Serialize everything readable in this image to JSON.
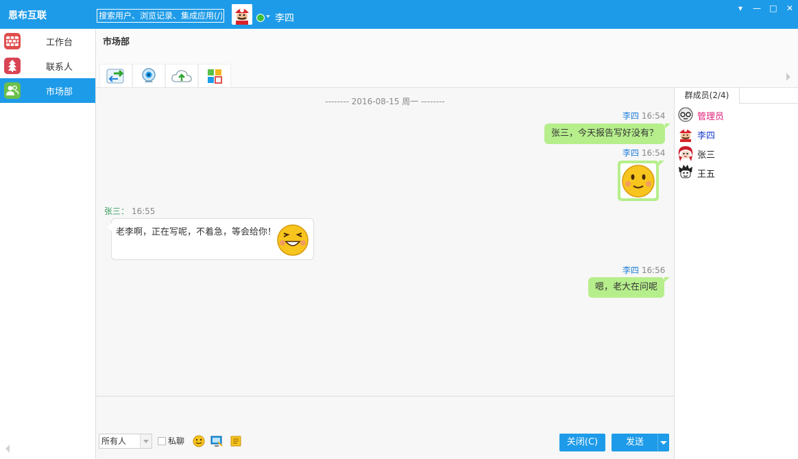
{
  "app": {
    "title": "恩布互联"
  },
  "search": {
    "placeholder": "搜索用户、浏览记录、集成应用(/)"
  },
  "current_user": {
    "name": "李四",
    "status": "online"
  },
  "window_controls": {
    "dropdown": "▾",
    "minimize": "—",
    "maximize": "□",
    "close": "✕"
  },
  "sidebar": {
    "items": [
      {
        "label": "工作台",
        "icon": "workbench-icon",
        "active": false
      },
      {
        "label": "联系人",
        "icon": "contacts-icon",
        "active": false
      },
      {
        "label": "市场部",
        "icon": "group-icon",
        "active": true
      }
    ]
  },
  "chat": {
    "title": "市场部",
    "toolbar": [
      {
        "icon": "file-transfer-icon"
      },
      {
        "icon": "video-call-icon"
      },
      {
        "icon": "upload-icon"
      },
      {
        "icon": "apps-icon"
      }
    ],
    "date_separator": "-------- 2016-08-15 周一 --------",
    "messages": [
      {
        "sender": "李四",
        "time": "16:54",
        "text": "张三，今天报告写好没有？",
        "direction": "out"
      },
      {
        "sender": "李四",
        "time": "16:54",
        "emoji": "smile-emoji",
        "direction": "out"
      },
      {
        "sender": "张三：",
        "time": "16:55",
        "text": "老李啊，正在写呢，不着急，等会给你！",
        "emoji": "grin-emoji",
        "direction": "in"
      },
      {
        "sender": "李四",
        "time": "16:56",
        "text": "嗯，老大在问呢",
        "direction": "out"
      }
    ]
  },
  "compose": {
    "recipient": "所有人",
    "private_label": "私聊",
    "close_button": "关闭(C)",
    "send_button": "发送"
  },
  "members": {
    "tab_label": "群成员(2/4)",
    "list": [
      {
        "name": "管理员",
        "color": "#e0207a"
      },
      {
        "name": "李四",
        "color": "#1a3fd0"
      },
      {
        "name": "张三",
        "color": "#222222"
      },
      {
        "name": "王五",
        "color": "#222222"
      }
    ]
  }
}
